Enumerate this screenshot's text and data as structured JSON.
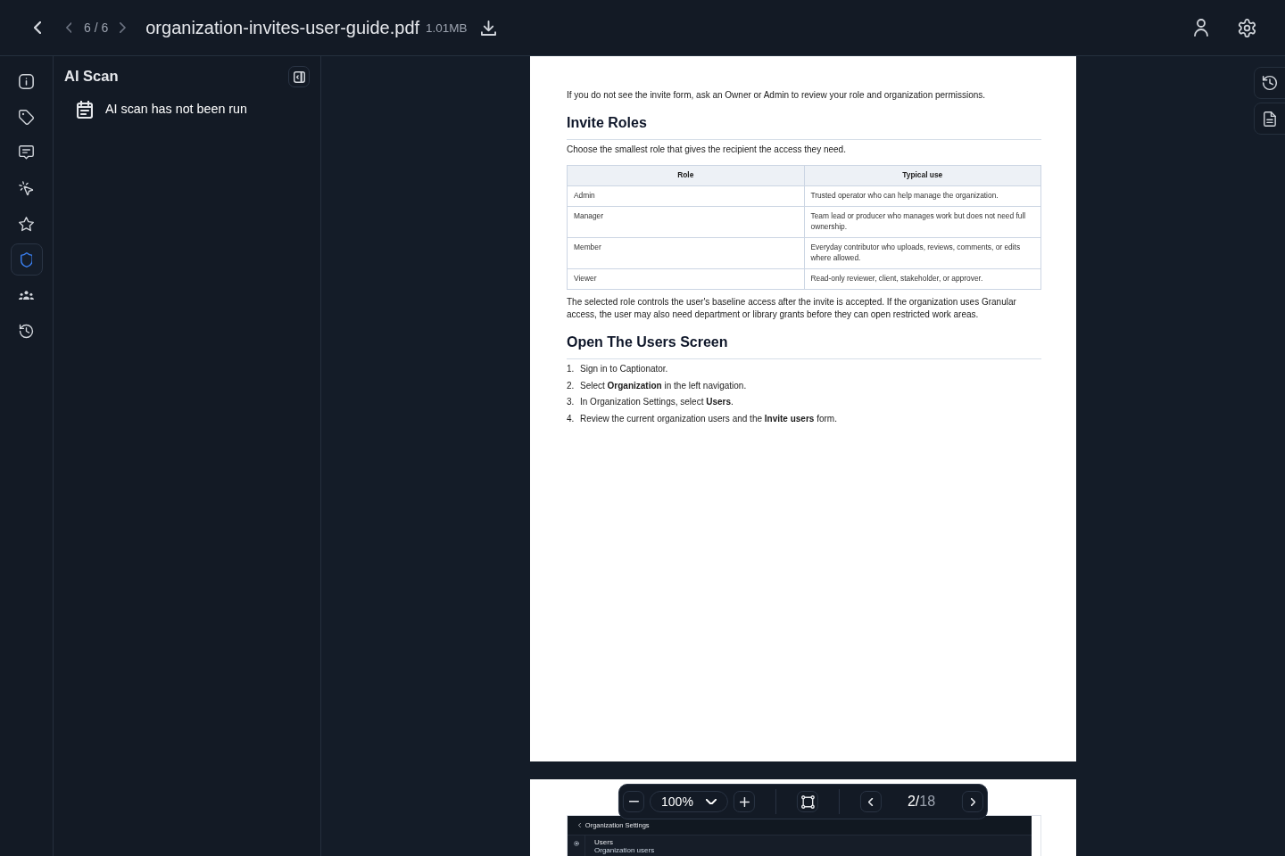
{
  "topbar": {
    "file_position": "6 / 6",
    "file_name": "organization-invites-user-guide.pdf",
    "file_size": "1.01MB"
  },
  "rail": [
    {
      "kind": "info",
      "selected": false
    },
    {
      "kind": "tags",
      "selected": false
    },
    {
      "kind": "comments",
      "selected": false
    },
    {
      "kind": "actions",
      "selected": false
    },
    {
      "kind": "favorites",
      "selected": false
    },
    {
      "kind": "scan",
      "selected": true
    },
    {
      "kind": "people",
      "selected": false
    },
    {
      "kind": "history",
      "selected": false
    }
  ],
  "panel": {
    "title": "AI Scan",
    "status": "AI scan has not been run"
  },
  "document": {
    "pages": [
      {
        "blocks": [
          {
            "kind": "paragraph",
            "text": "If you do not see the invite form, ask an Owner or Admin to review your role and organization permissions."
          },
          {
            "kind": "heading",
            "text": "Invite Roles"
          },
          {
            "kind": "paragraph",
            "text": "Choose the smallest role that gives the recipient the access they need."
          },
          {
            "kind": "table",
            "columns": [
              "Role",
              "Typical use"
            ],
            "rows": [
              [
                "Admin",
                "Trusted operator who can help manage the organization."
              ],
              [
                "Manager",
                "Team lead or producer who manages work but does not need full ownership."
              ],
              [
                "Member",
                "Everyday contributor who uploads, reviews, comments, or edits where allowed."
              ],
              [
                "Viewer",
                "Read-only reviewer, client, stakeholder, or approver."
              ]
            ]
          },
          {
            "kind": "paragraph",
            "text": "The selected role controls the user's baseline access after the invite is accepted. If the organization uses Granular access, the user may also need department or library grants before they can open restricted work areas."
          },
          {
            "kind": "heading",
            "text": "Open The Users Screen"
          },
          {
            "kind": "list",
            "items": [
              {
                "number": "1.",
                "text": "Sign in to Captionator."
              },
              {
                "number": "2.",
                "text": "Select **Organization** in the left navigation."
              },
              {
                "number": "3.",
                "text": "In Organization Settings, select **Users**."
              },
              {
                "number": "4.",
                "text": "Review the current organization users and the **Invite users** form."
              }
            ]
          }
        ]
      },
      {
        "blocks": [
          {
            "kind": "screenshot",
            "title": "Organization Settings",
            "heading": "Users",
            "subheading": "Organization users"
          }
        ]
      }
    ]
  },
  "toolbar": {
    "zoom": "100%",
    "page": "2",
    "separator": "/",
    "total": "18"
  }
}
